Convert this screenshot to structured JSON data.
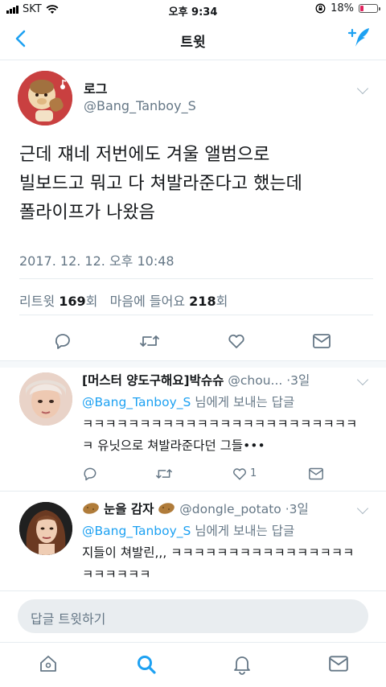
{
  "status_bar": {
    "carrier": "SKT",
    "time": "오후 9:34",
    "battery": "18%",
    "battery_level": 0.18
  },
  "nav": {
    "title": "트윗"
  },
  "main_tweet": {
    "name": "로그",
    "handle": "@Bang_Tanboy_S",
    "text_lines": [
      "근데 쟤네 저번에도 겨울 앨범으로",
      "빌보드고 뭐고 다 쳐발라준다고 했는데",
      "폴라이프가 나왔음"
    ],
    "timestamp": "2017. 12. 12. 오후 10:48",
    "stats": {
      "retweet_label": "리트윗",
      "retweet_count": "169",
      "retweet_unit": "회",
      "like_label": "마음에 들어요",
      "like_count": "218",
      "like_unit": "회"
    }
  },
  "replies": [
    {
      "name": "[머스터 양도구해요]박슈슈",
      "handle": "@chou...",
      "date": "·3일",
      "to_handle": "@Bang_Tanboy_S",
      "to_suffix": " 님에게 보내는 답글",
      "text": "ㅋㅋㅋㅋㅋㅋㅋㅋㅋㅋㅋㅋㅋㅋㅋㅋㅋㅋㅋㅋㅋㅋㅋㅋㅋ 유닛으로 쳐발라준다던 그들•••",
      "like_count": "1"
    },
    {
      "name": "눈을 감자",
      "handle": "@dongle_potato",
      "date": "·3일",
      "to_handle": "@Bang_Tanboy_S",
      "to_suffix": " 님에게 보내는 답글",
      "text": "지들이 쳐발린,,, ㅋㅋㅋㅋㅋㅋㅋㅋㅋㅋㅋㅋㅋㅋㅋㅋㅋㅋㅋㅋㅋㅋ",
      "like_count": ""
    }
  ],
  "composer": {
    "placeholder": "답글 트윗하기"
  },
  "tabs": [
    "home-icon",
    "search-icon",
    "notifications-icon",
    "messages-icon"
  ],
  "colors": {
    "accent": "#1da1f2",
    "secondary_text": "#657786",
    "divider": "#e6ecf0",
    "battery_low": "#e0245e"
  }
}
